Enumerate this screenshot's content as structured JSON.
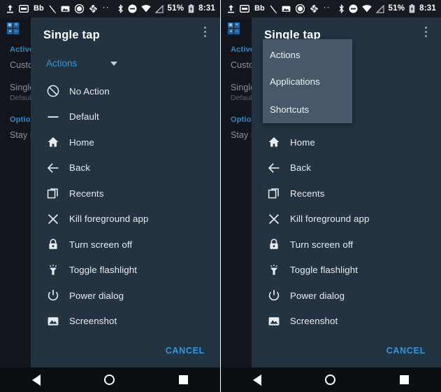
{
  "status_bar": {
    "icons_left": [
      "upload-icon",
      "card-icon",
      "bb-icon",
      "pen-icon",
      "image-icon",
      "circle-icon",
      "sync-icon",
      "more-dots-icon"
    ],
    "bb_label": "Bb",
    "dots_label": "··",
    "icons_right": [
      "bluetooth-icon",
      "dnd-icon",
      "wifi-icon",
      "signal-icon"
    ],
    "battery_percent": "51%",
    "time": "8:31"
  },
  "background_app": {
    "logo_glyphs": [
      "▣",
      "✳",
      "◂",
      "⌂"
    ],
    "sections": [
      {
        "header": "Active",
        "rows": [
          {
            "title": "Custo",
            "subtitle": "",
            "control": "toggle-on"
          }
        ]
      },
      {
        "header": "",
        "rows": [
          {
            "title": "Single",
            "subtitle": "Defaul",
            "control": "dash"
          }
        ]
      },
      {
        "header": "Option",
        "rows": [
          {
            "title": "Stay i",
            "subtitle": "",
            "control": "toggle-off"
          }
        ]
      }
    ]
  },
  "dialog": {
    "title": "Single tap",
    "kebab": "overflow-menu",
    "spinner": {
      "selected": "Actions",
      "caret": "chevron-down-icon",
      "options": [
        "Actions",
        "Applications",
        "Shortcuts"
      ]
    },
    "items": [
      {
        "icon": "no-action-icon",
        "label": "No Action"
      },
      {
        "icon": "default-icon",
        "label": "Default"
      },
      {
        "icon": "home-icon",
        "label": "Home"
      },
      {
        "icon": "back-arrow-icon",
        "label": "Back"
      },
      {
        "icon": "recents-icon",
        "label": "Recents"
      },
      {
        "icon": "close-x-icon",
        "label": "Kill foreground app"
      },
      {
        "icon": "lock-icon",
        "label": "Turn screen off"
      },
      {
        "icon": "flashlight-icon",
        "label": "Toggle flashlight"
      },
      {
        "icon": "power-icon",
        "label": "Power dialog"
      },
      {
        "icon": "image-icon",
        "label": "Screenshot"
      }
    ],
    "cancel_label": "CANCEL"
  },
  "nav_bar": {
    "back": "back-triangle-icon",
    "home": "home-circle-icon",
    "recents": "recents-square-icon"
  },
  "colors": {
    "dialog_bg": "#243342",
    "dropdown_bg": "#47586a",
    "accent": "#2f97e0",
    "screen_bg": "#12161c",
    "status_bg": "#161b22",
    "nav_bg": "#0b0e13"
  }
}
